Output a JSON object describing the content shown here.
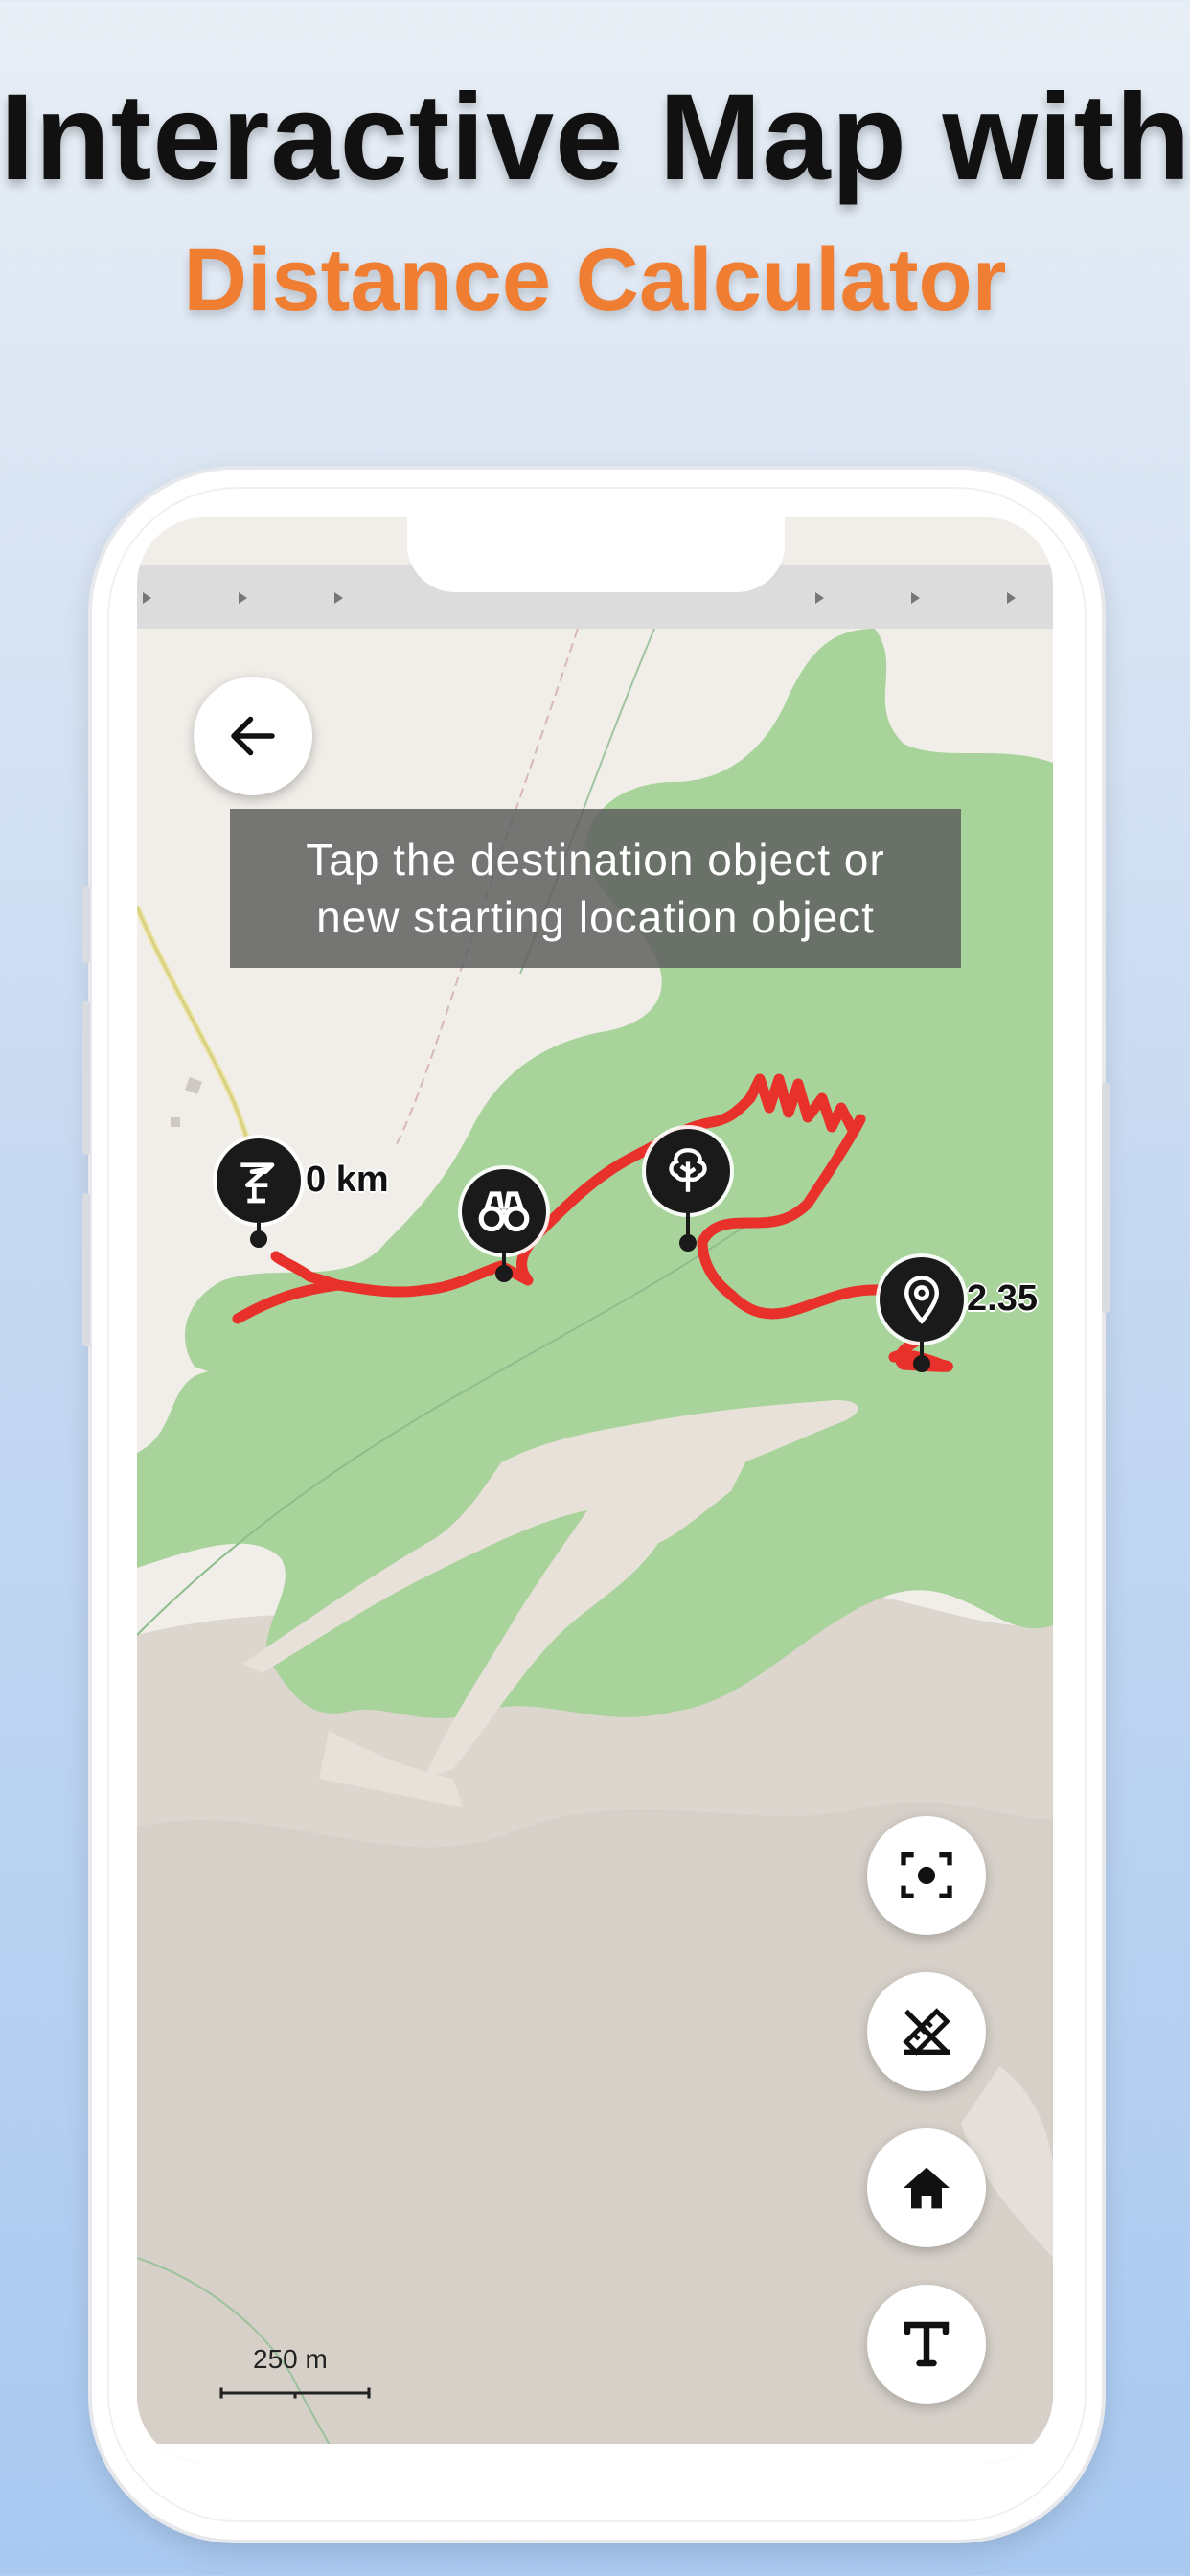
{
  "headline": {
    "line1": "Interactive Map with",
    "line2": "Distance Calculator"
  },
  "map": {
    "hint_line1": "Tap the destination object or",
    "hint_line2": "new starting location object",
    "start_label": "0 km",
    "end_label": "2.35",
    "scale_label": "250 m"
  },
  "icons": {
    "back": "arrow-left-icon",
    "start_pin": "signpost-icon",
    "viewpoint_pin": "binoculars-icon",
    "tree_pin": "tree-icon",
    "end_pin": "location-marker-icon",
    "focus": "focus-location-icon",
    "ruler_off": "ruler-off-icon",
    "home": "home-icon",
    "text": "text-icon"
  },
  "colors": {
    "accent": "#ef7d32",
    "route": "#e8312a",
    "forest": "#a8d39b",
    "land": "#f1eee9",
    "rock": "#d9d3cc"
  }
}
